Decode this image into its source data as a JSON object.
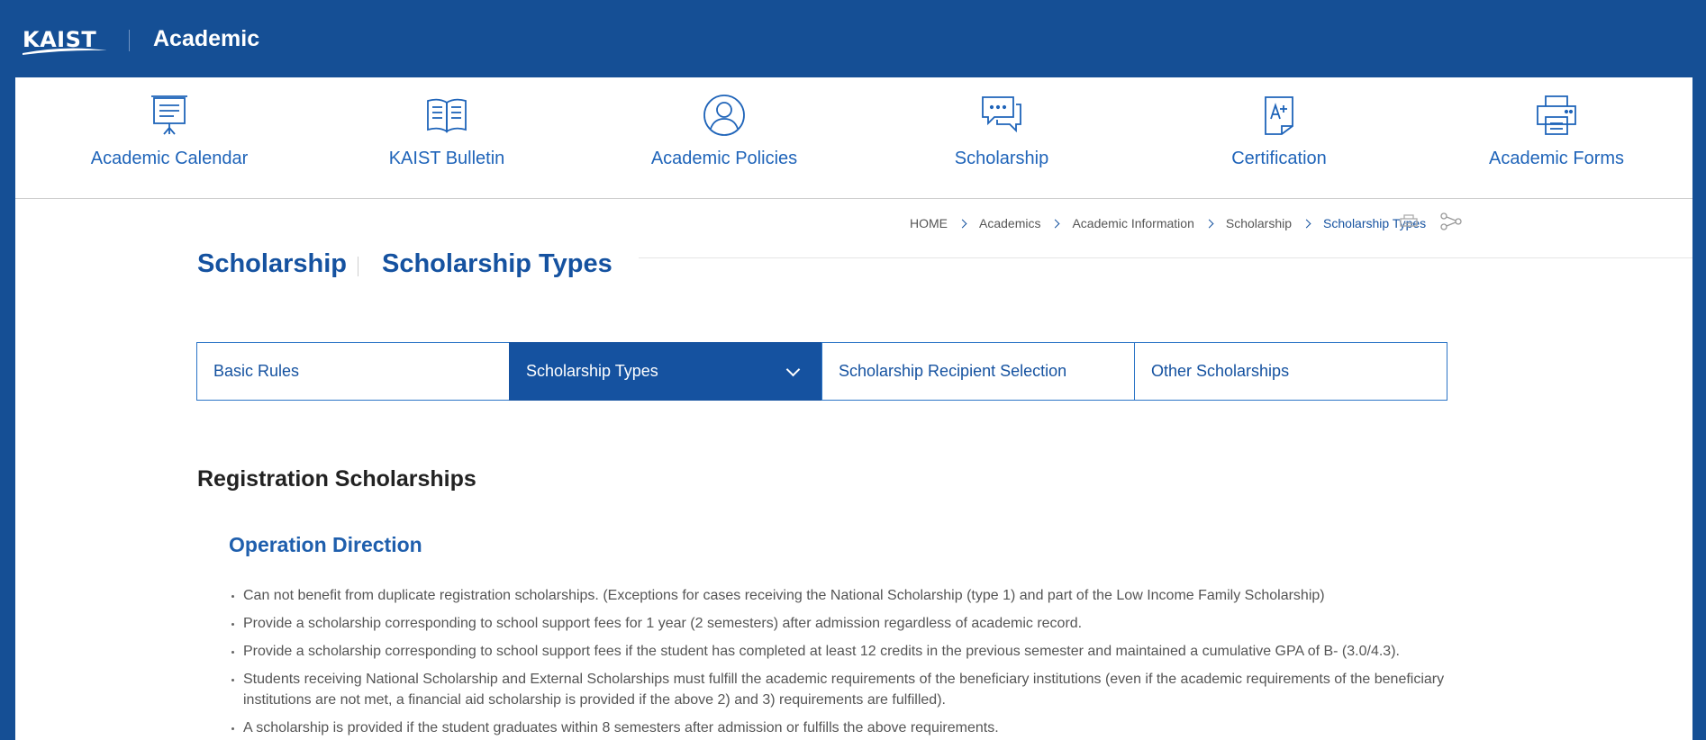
{
  "header": {
    "logo_text": "KAIST",
    "site_title": "Academic"
  },
  "quick_menu": [
    {
      "label": "Academic Calendar",
      "icon": "presentation-board-icon"
    },
    {
      "label": "KAIST Bulletin",
      "icon": "open-book-icon"
    },
    {
      "label": "Academic Policies",
      "icon": "user-circle-icon"
    },
    {
      "label": "Scholarship",
      "icon": "chat-bubbles-icon"
    },
    {
      "label": "Certification",
      "icon": "certificate-document-icon"
    },
    {
      "label": "Academic Forms",
      "icon": "printer-icon"
    }
  ],
  "breadcrumb": [
    "HOME",
    "Academics",
    "Academic Information",
    "Scholarship",
    "Scholarship Types"
  ],
  "tools": {
    "print_icon": "print-icon",
    "share_icon": "share-icon"
  },
  "page_title": {
    "main": "Scholarship",
    "sub": "Scholarship Types"
  },
  "tabs": [
    {
      "label": "Basic Rules"
    },
    {
      "label": "Scholarship Types",
      "active": true
    },
    {
      "label": "Scholarship Recipient Selection"
    },
    {
      "label": "Other Scholarships"
    }
  ],
  "content": {
    "section_title": "Registration Scholarships",
    "sub_title": "Operation Direction",
    "bullets": [
      "Can not benefit from duplicate registration scholarships. (Exceptions for cases receiving the National Scholarship (type 1) and part of the Low Income Family Scholarship)",
      "Provide a scholarship corresponding to school support fees for 1 year (2 semesters) after admission regardless of academic record.",
      "Provide a scholarship corresponding to school support fees if the student has completed at least 12 credits in the previous semester and maintained a cumulative GPA of B- (3.0/4.3).",
      "Students receiving National Scholarship and External Scholarships must fulfill the academic requirements of the beneficiary institutions (even if the academic requirements of the beneficiary institutions are not met, a financial aid scholarship is provided if the above 2) and 3) requirements are fulfilled).",
      "A scholarship is provided if the student graduates within 8 semesters after admission or fulfills the above requirements."
    ]
  },
  "colors": {
    "brand_blue": "#154f95",
    "accent_blue": "#1f64b9",
    "active_tab": "#1552a0"
  }
}
